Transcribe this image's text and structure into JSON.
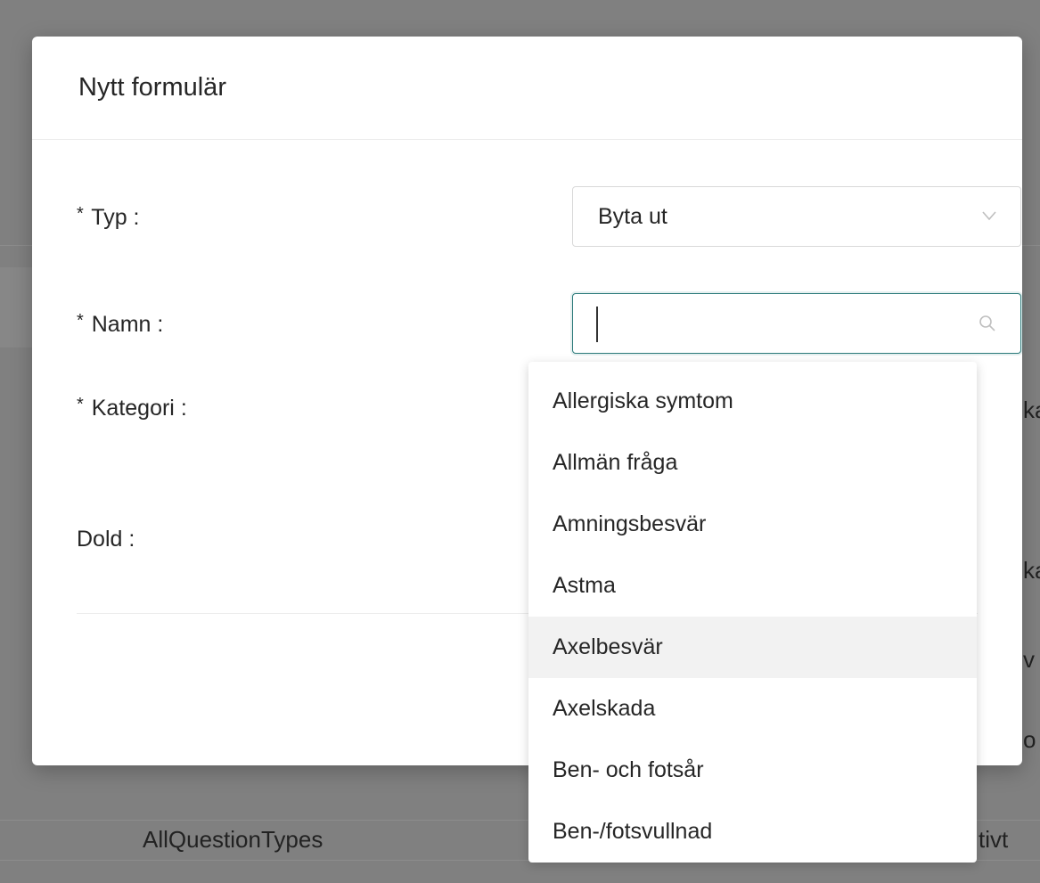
{
  "background": {
    "cells": [
      "AllQuestionTypes",
      "ka",
      "ka",
      "v",
      "o",
      "tivt"
    ]
  },
  "modal": {
    "title": "Nytt formulär"
  },
  "form": {
    "type": {
      "required": "*",
      "label": "Typ",
      "colon": ":",
      "value": "Byta ut"
    },
    "name": {
      "required": "*",
      "label": "Namn",
      "colon": ":",
      "value": ""
    },
    "category": {
      "required": "*",
      "label": "Kategori",
      "colon": ":"
    },
    "hidden": {
      "label": "Dold",
      "colon": ":"
    }
  },
  "dropdown": {
    "options": [
      "Allergiska symtom",
      "Allmän fråga",
      "Amningsbesvär",
      "Astma",
      "Axelbesvär",
      "Axelskada",
      "Ben- och fotsår",
      "Ben-/fotsvullnad"
    ],
    "hovered": "Axelbesvär"
  },
  "icons": {
    "type_arrow": "chevron-down-icon",
    "name_search": "search-icon"
  }
}
